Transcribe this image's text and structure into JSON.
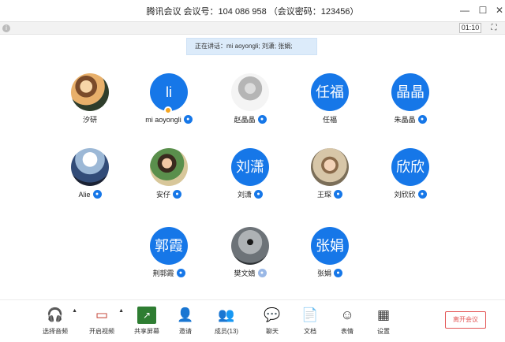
{
  "window": {
    "title": "腾讯会议 会议号：104 086 958 （会议密码：123456）",
    "minimize_icon": "minimize-icon",
    "maximize_icon": "maximize-icon",
    "close_icon": "close-icon"
  },
  "status_bar": {
    "timer": "01:10"
  },
  "speaking_banner": "正在讲话：mi aoyongli; 刘潇; 张娟;",
  "participants": [
    {
      "name": "汐研",
      "avatar_type": "photo1",
      "mic": "none"
    },
    {
      "name": "mi aoyongli",
      "avatar_text": "li",
      "mic": "on",
      "badge": true
    },
    {
      "name": "赵晶晶",
      "avatar_type": "photo6",
      "mic": "on"
    },
    {
      "name": "任福",
      "avatar_text": "任福",
      "mic": "none"
    },
    {
      "name": "朱晶晶",
      "avatar_text": "晶晶",
      "mic": "on"
    },
    {
      "name": "Alie",
      "avatar_type": "photo2",
      "mic": "on"
    },
    {
      "name": "安仔",
      "avatar_type": "photo3",
      "mic": "on"
    },
    {
      "name": "刘潇",
      "avatar_text": "刘潇",
      "mic": "on"
    },
    {
      "name": "王琛",
      "avatar_type": "photo4",
      "mic": "on"
    },
    {
      "name": "刘欣欣",
      "avatar_text": "欣欣",
      "mic": "on"
    },
    {
      "name": "荆郭霞",
      "avatar_text": "郭霞",
      "mic": "on"
    },
    {
      "name": "樊文婧",
      "avatar_type": "photo5",
      "mic": "muted"
    },
    {
      "name": "张娟",
      "avatar_text": "张娟",
      "mic": "on"
    }
  ],
  "toolbar": {
    "audio_label": "选择音频",
    "video_label": "开启视频",
    "share_label": "共享屏幕",
    "invite_label": "邀请",
    "members_label": "成员(13)",
    "chat_label": "聊天",
    "docs_label": "文档",
    "emoji_label": "表情",
    "settings_label": "设置",
    "leave_label": "离开会议"
  },
  "colors": {
    "accent": "#1677e8",
    "leave": "#e35757",
    "speaking_bg": "#dcebfa"
  }
}
